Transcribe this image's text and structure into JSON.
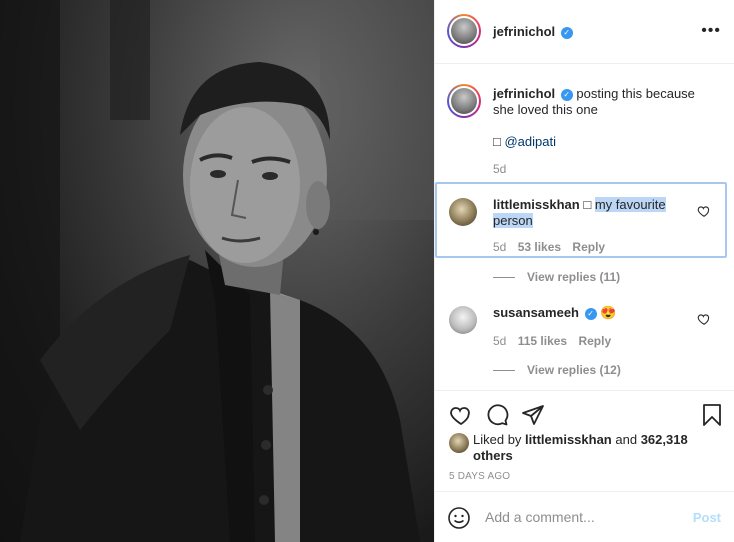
{
  "post": {
    "author": "jefrinichol",
    "caption_text": "posting this because she loved this one",
    "caption_tag_prefix": "□",
    "caption_mention": "@adipati",
    "caption_age": "5d",
    "more_label": "•••"
  },
  "comments": [
    {
      "username": "littlemisskhan",
      "prefix": "□",
      "text": "my favourite person",
      "age": "5d",
      "likes": "53 likes",
      "reply_label": "Reply",
      "view_replies": "View replies (11)"
    },
    {
      "username": "susansameeh",
      "text": "😍",
      "age": "5d",
      "likes": "115 likes",
      "reply_label": "Reply",
      "view_replies": "View replies (12)"
    }
  ],
  "likes_summary": {
    "prefix": "Liked by",
    "user": "littlemisskhan",
    "conj": "and",
    "others": "362,318 others"
  },
  "timestamp": "5 DAYS AGO",
  "comment_input": {
    "placeholder": "Add a comment...",
    "post_label": "Post"
  },
  "icons": {
    "like": "heart-icon",
    "comment": "comment-bubble-icon",
    "share": "paper-plane-icon",
    "save": "bookmark-icon",
    "emoji": "smiley-icon",
    "verified": "verified-badge-icon"
  },
  "colors": {
    "verified": "#3897f0",
    "link": "#00376b",
    "muted": "#8e8e8e",
    "post_button": "#b2dffc",
    "selection": "#bcd6f6"
  }
}
